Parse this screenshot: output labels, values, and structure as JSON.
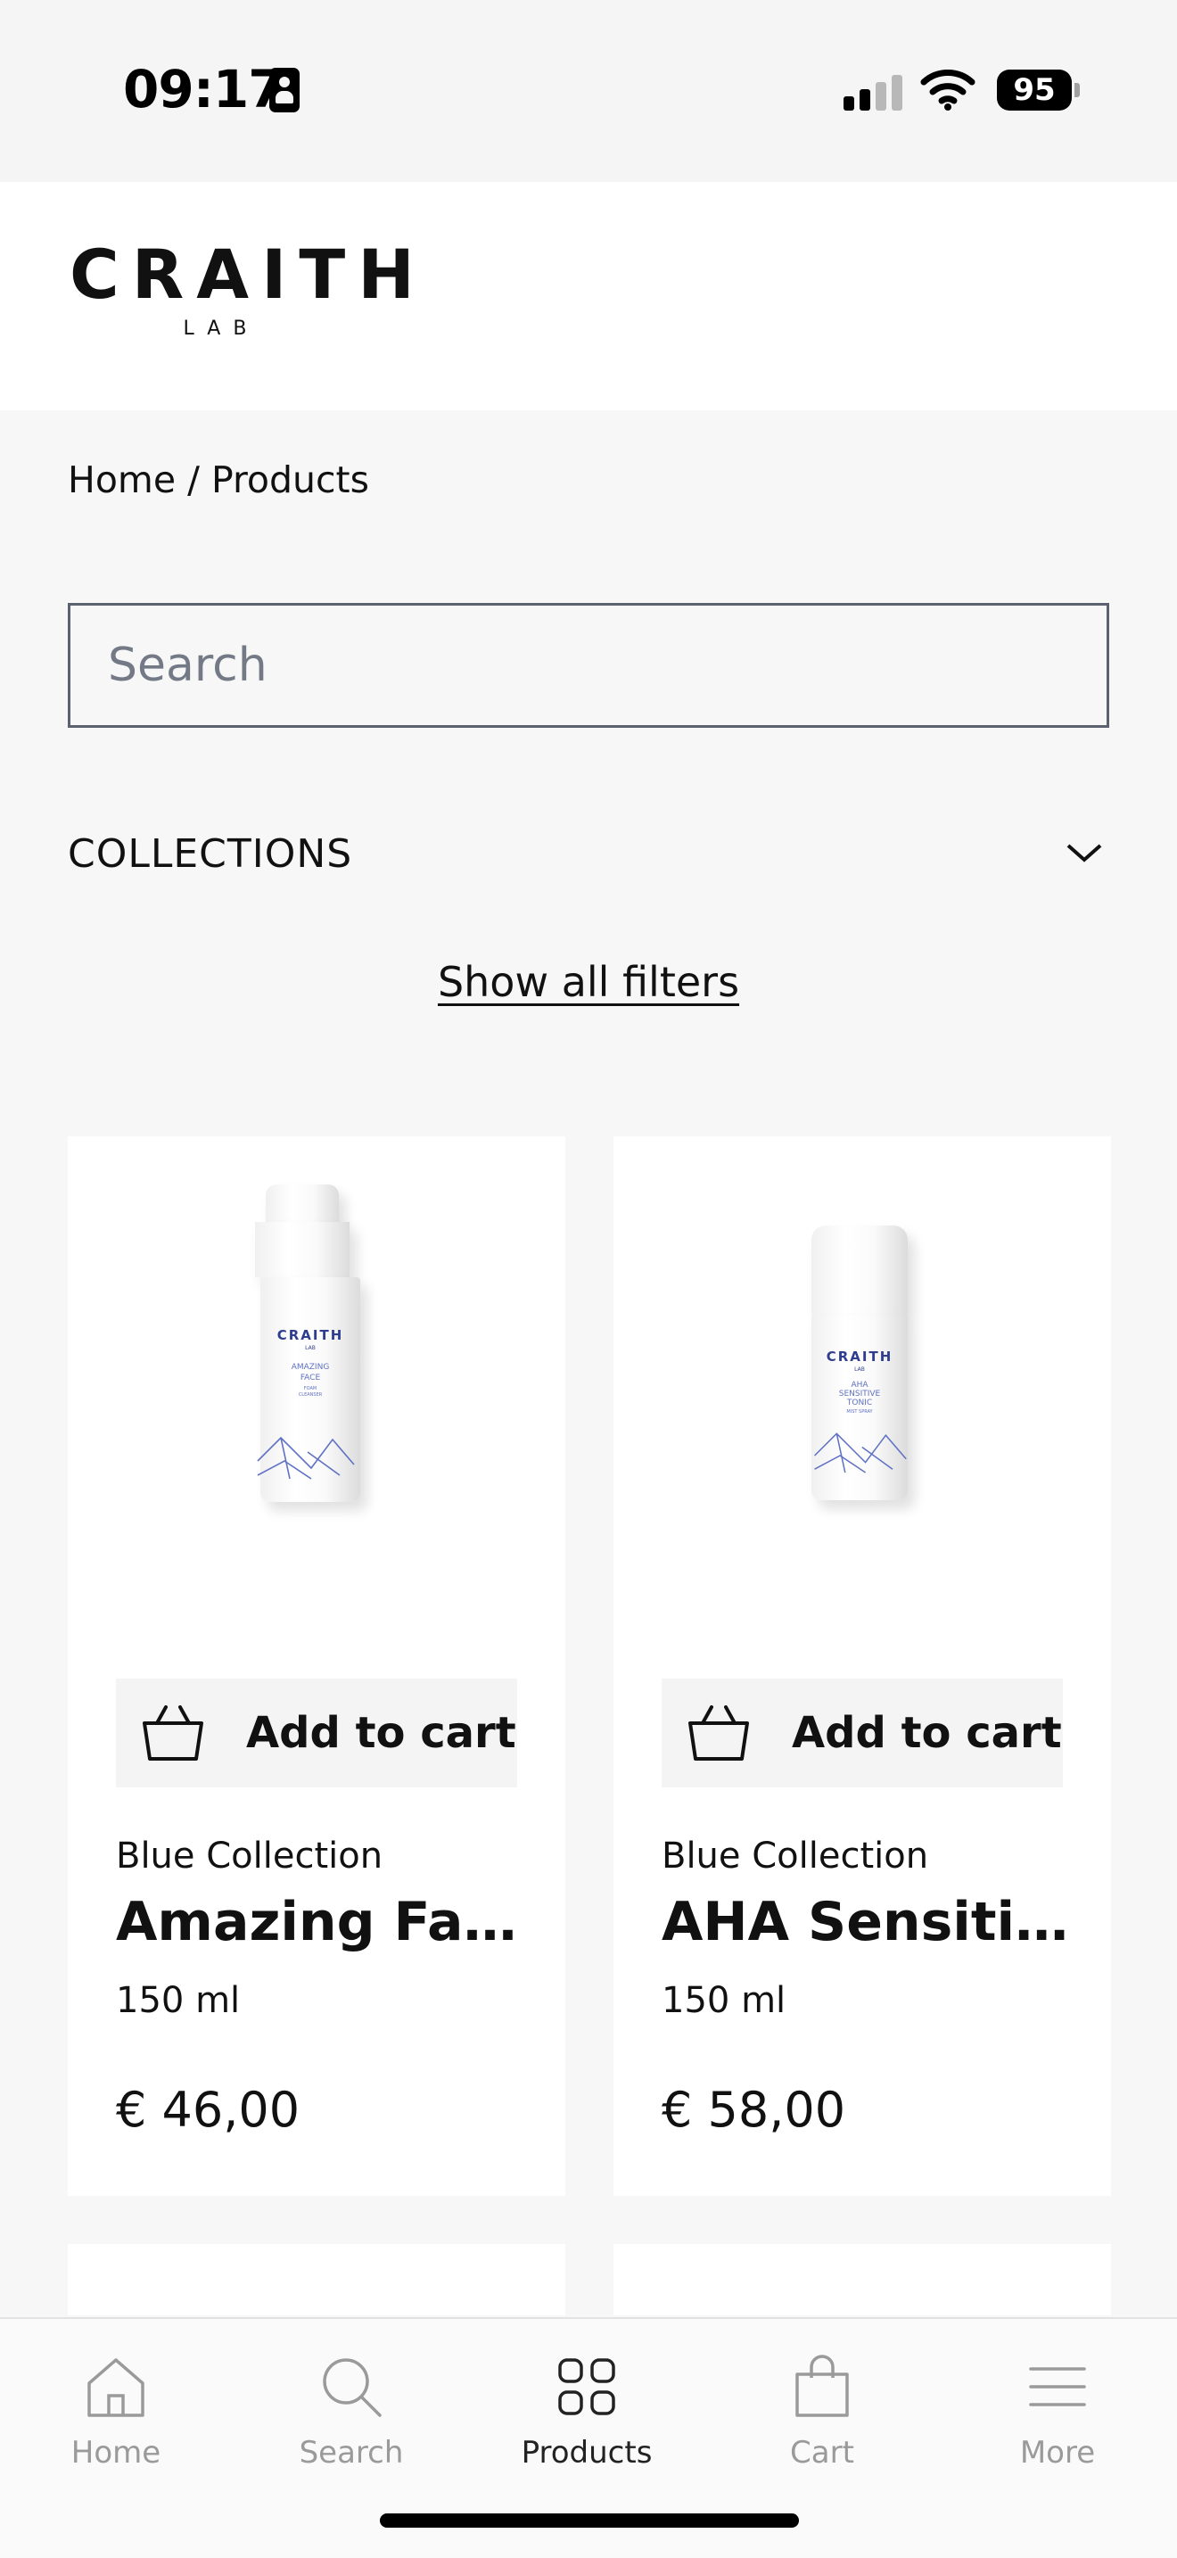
{
  "status_bar": {
    "time": "09:17",
    "battery": "95"
  },
  "brand": {
    "logo_main": "CRAITH",
    "logo_sub": "LAB"
  },
  "breadcrumb": "Home / Products",
  "search": {
    "placeholder": "Search",
    "value": ""
  },
  "collections": {
    "label": "COLLECTIONS"
  },
  "filters": {
    "show_all_label": "Show all filters"
  },
  "products": [
    {
      "add_to_cart_label": "Add to cart",
      "collection": "Blue Collection",
      "name": "Amazing Fac...",
      "size": "150 ml",
      "price": "€ 46,00",
      "image_label": {
        "brand": "CRAITH",
        "sub": "LAB",
        "line1": "AMAZING",
        "line2": "FACE",
        "line3": "FOAM",
        "line4": "CLEANSER"
      }
    },
    {
      "add_to_cart_label": "Add to cart",
      "collection": "Blue Collection",
      "name": "AHA Sensitiv...",
      "size": "150 ml",
      "price": "€ 58,00",
      "image_label": {
        "brand": "CRAITH",
        "sub": "LAB",
        "line1": "AHA",
        "line2": "SENSITIVE",
        "line3": "TONIC",
        "line4": "MIST SPRAY"
      }
    }
  ],
  "tab_bar": {
    "items": [
      {
        "label": "Home",
        "icon": "home-icon",
        "active": false
      },
      {
        "label": "Search",
        "icon": "search-icon",
        "active": false
      },
      {
        "label": "Products",
        "icon": "grid-icon",
        "active": true
      },
      {
        "label": "Cart",
        "icon": "bag-icon",
        "active": false
      },
      {
        "label": "More",
        "icon": "menu-icon",
        "active": false
      }
    ]
  },
  "colors": {
    "accent": "#2f3d8f",
    "background": "#f7f7f7",
    "text": "#111111"
  }
}
